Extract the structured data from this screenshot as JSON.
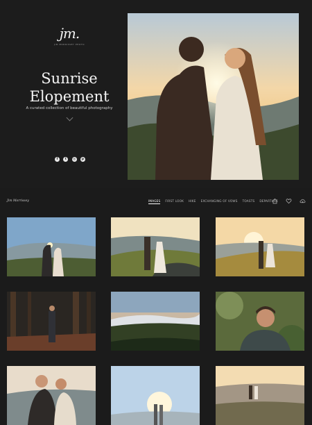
{
  "hero": {
    "logo_mark": "jm.",
    "logo_sub": "JIM MORRISSEY PHOTO",
    "title_line1": "Sunrise",
    "title_line2": "Elopement",
    "tagline": "A curated collection of beautiful photography",
    "social": [
      {
        "icon": "facebook-icon",
        "glyph": "f"
      },
      {
        "icon": "twitter-icon",
        "glyph": "t"
      },
      {
        "icon": "instagram-icon",
        "glyph": "◎"
      },
      {
        "icon": "pinterest-icon",
        "glyph": "p"
      }
    ]
  },
  "nav": {
    "brand": "Jim Morrissey",
    "menu": [
      "IMAGES",
      "FIRST LOOK",
      "HIKE",
      "EXCHANGING OF VOWS",
      "TOASTS",
      "DEPARTURE"
    ],
    "active_index": 0,
    "icons": [
      "home-icon",
      "heart-icon",
      "cloud-download-icon"
    ]
  },
  "gallery": {
    "tiles": [
      {
        "kind": "couple-kiss-sky"
      },
      {
        "kind": "couple-walk-rocks"
      },
      {
        "kind": "couple-field-sunset"
      },
      {
        "kind": "forest-groom"
      },
      {
        "kind": "mountain-valley-fog"
      },
      {
        "kind": "groom-portrait"
      },
      {
        "kind": "couple-closeup"
      },
      {
        "kind": "sky-silhouette"
      },
      {
        "kind": "couple-distant"
      }
    ]
  },
  "colors": {
    "background": "#1b1b1b",
    "sunset": "#f6c77a",
    "mountain": "#5b6f78",
    "forest": "#2f3b22"
  }
}
